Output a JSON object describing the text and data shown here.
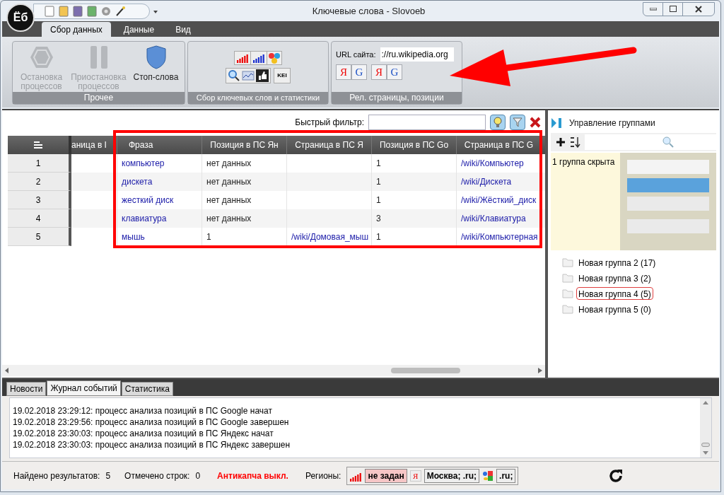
{
  "window": {
    "title": "Ключевые слова - Slovoeb",
    "logo": "Ёб"
  },
  "ribbon_tabs": [
    {
      "label": "Сбор данных",
      "selected": true
    },
    {
      "label": "Данные",
      "selected": false
    },
    {
      "label": "Вид",
      "selected": false
    }
  ],
  "group_other": {
    "label": "Прочее",
    "buttons": [
      {
        "kind": "stop",
        "label": "Остановка процессов",
        "disabled": true
      },
      {
        "kind": "pause",
        "label": "Приостановка процессов",
        "disabled": true
      },
      {
        "kind": "shield",
        "label": "Стоп-слова",
        "disabled": false
      }
    ]
  },
  "group_collect": {
    "label": "Сбор ключевых слов и статистики",
    "kei": "KEI"
  },
  "group_positions": {
    "label": "Рел. страницы, позиции",
    "url_label": "URL сайта:",
    "url_value": "://ru.wikipedia.org",
    "engines": [
      {
        "kind": "yandex",
        "glyph": "Я"
      },
      {
        "kind": "google",
        "glyph": "G"
      },
      {
        "kind": "yandex",
        "glyph": "Я"
      },
      {
        "kind": "google",
        "glyph": "G"
      }
    ]
  },
  "filter": {
    "label": "Быстрый фильтр:"
  },
  "table": {
    "columns": [
      "аница в I",
      "Фраза",
      "Позиция в ПС Ян",
      "Страница в ПС Я",
      "Позиция в ПС Go",
      "Страница в ПС G"
    ],
    "rows": [
      {
        "number": "1",
        "cells": [
          "",
          "компьютер",
          "нет данных",
          "",
          "1",
          "/wiki/Компьютер"
        ]
      },
      {
        "number": "2",
        "cells": [
          "",
          "дискета",
          "нет данных",
          "",
          "1",
          "/wiki/Дискета"
        ]
      },
      {
        "number": "3",
        "cells": [
          "",
          "жесткий диск",
          "нет данных",
          "",
          "1",
          "/wiki/Жёсткий_диск"
        ]
      },
      {
        "number": "4",
        "cells": [
          "",
          "клавиатура",
          "нет данных",
          "",
          "3",
          "/wiki/Клавиатура"
        ]
      },
      {
        "number": "5",
        "cells": [
          "",
          "мышь",
          "1",
          "/wiki/Домовая_мыш",
          "1",
          "/wiki/Компьютерная"
        ]
      }
    ]
  },
  "groups_panel": {
    "title": "Управление группами",
    "hidden_note": "1 группа скрыта",
    "groups": [
      {
        "label": "Новая группа 2 (17)",
        "selected": false
      },
      {
        "label": "Новая группа 3 (2)",
        "selected": false
      },
      {
        "label": "Новая группа 4 (5)",
        "selected": true
      },
      {
        "label": "Новая группа 5 (0)",
        "selected": false
      }
    ]
  },
  "bottom_tabs": [
    {
      "label": "Новости",
      "selected": false
    },
    {
      "label": "Журнал событий",
      "selected": true
    },
    {
      "label": "Статистика",
      "selected": false
    }
  ],
  "log": [
    "19.02.2018 23:29:12: процесс анализа позиций в ПС Google начат",
    "19.02.2018 23:29:56: процесс анализа позиций в ПС Google завершен",
    "19.02.2018 23:30:03: процесс анализа позиций в ПС Яндекс начат",
    "19.02.2018 23:30:03: процесс анализа позиций в ПС Яндекс завершен"
  ],
  "status": {
    "found_label": "Найдено результатов:",
    "found": "5",
    "marked_label": "Отмечено строк:",
    "marked": "0",
    "anticaptcha": "Антикапча выкл.",
    "regions_label": "Регионы:",
    "regions": [
      {
        "kind": "stats",
        "value": "не задан"
      },
      {
        "kind": "yandex",
        "glyph": "Я",
        "value": "Москва; .ru;"
      },
      {
        "kind": "google",
        "value": ".ru;"
      }
    ]
  }
}
